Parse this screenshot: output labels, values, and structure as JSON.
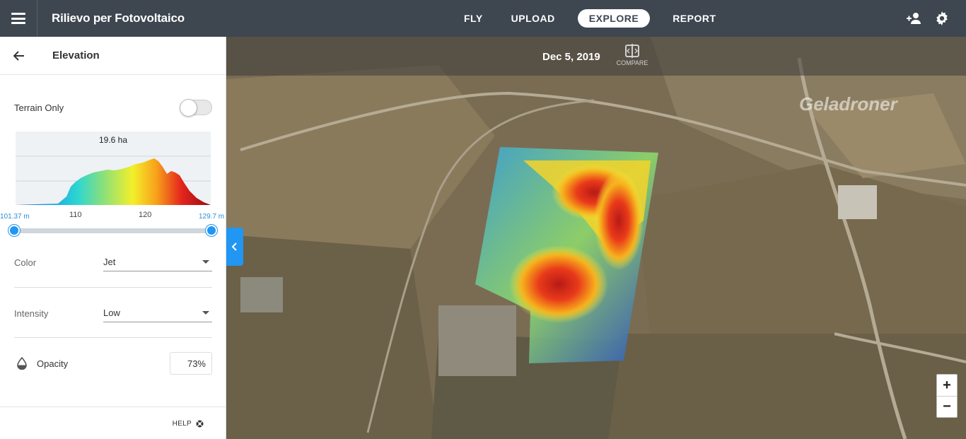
{
  "header": {
    "title": "Rilievo per Fotovoltaico",
    "nav": [
      {
        "label": "FLY",
        "active": false
      },
      {
        "label": "UPLOAD",
        "active": false
      },
      {
        "label": "EXPLORE",
        "active": true
      },
      {
        "label": "REPORT",
        "active": false
      }
    ],
    "icons": [
      "menu-icon",
      "add-user-icon",
      "gear-icon"
    ]
  },
  "sidebar": {
    "title": "Elevation",
    "terrain_only_label": "Terrain Only",
    "terrain_only_on": false,
    "histogram": {
      "area_label": "19.6 ha",
      "min_label": "101.37 m",
      "max_label": "129.7 m",
      "tick_110": "110",
      "tick_120": "120"
    },
    "color_label": "Color",
    "color_value": "Jet",
    "intensity_label": "Intensity",
    "intensity_value": "Low",
    "opacity_label": "Opacity",
    "opacity_value": "73%",
    "help_label": "HELP"
  },
  "map": {
    "date": "Dec 5, 2019",
    "compare_label": "COMPARE",
    "zoom_in": "+",
    "zoom_out": "−",
    "watermark": "Geladroner",
    "colors": {
      "accent": "#2196f3",
      "topbar": "#3e4650"
    }
  }
}
